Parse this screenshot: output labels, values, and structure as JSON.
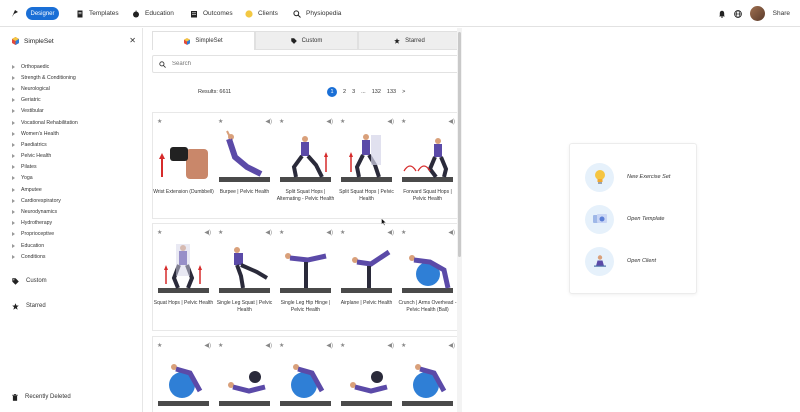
{
  "nav": {
    "designer_label": "Designer",
    "items": [
      "Templates",
      "Education",
      "Outcomes",
      "Clients",
      "Physiopedia"
    ],
    "share_label": "Share"
  },
  "sidebar": {
    "title": "SimpleSet",
    "categories": [
      "Orthopaedic",
      "Strength & Conditioning",
      "Neurological",
      "Geriatric",
      "Vestibular",
      "Vocational Rehabilitation",
      "Women's Health",
      "Paediatrics",
      "Pelvic Health",
      "Pilates",
      "Yoga",
      "Amputee",
      "Cardiorespiratory",
      "Neurodynamics",
      "Hydrotherapy",
      "Proprioceptive",
      "Education",
      "Conditions"
    ],
    "custom_label": "Custom",
    "starred_label": "Starred",
    "recently_deleted_label": "Recently Deleted"
  },
  "tabs": [
    "SimpleSet",
    "Custom",
    "Starred"
  ],
  "search": {
    "placeholder": "Search"
  },
  "results": {
    "label": "Results: 6611"
  },
  "pagination": [
    "1",
    "2",
    "3",
    "...",
    "132",
    "133",
    ">"
  ],
  "cards": [
    [
      "Wrist Extension (Dumbbell)",
      "Burpee | Pelvic Health",
      "Split Squat Hops | Alternating - Pelvic Health",
      "Split Squat Hops | Pelvic Health",
      "Forward Squat Hops | Pelvic Health"
    ],
    [
      "Squat Hops | Pelvic Health",
      "Single Leg Squat | Pelvic Health",
      "Single Leg Hip Hinge | Pelvic Health",
      "Airplane | Pelvic Health",
      "Crunch | Arms Overhead - Pelvic Health (Ball)"
    ],
    [
      "",
      "",
      "",
      "",
      ""
    ]
  ],
  "quick_start": [
    "New Exercise Set",
    "Open Template",
    "Open Client"
  ],
  "colors": {
    "accent": "#1a6fd6",
    "figure_top": "#5b4aa8",
    "figure_skin": "#d9a07a",
    "ball": "#2f7fd6"
  }
}
